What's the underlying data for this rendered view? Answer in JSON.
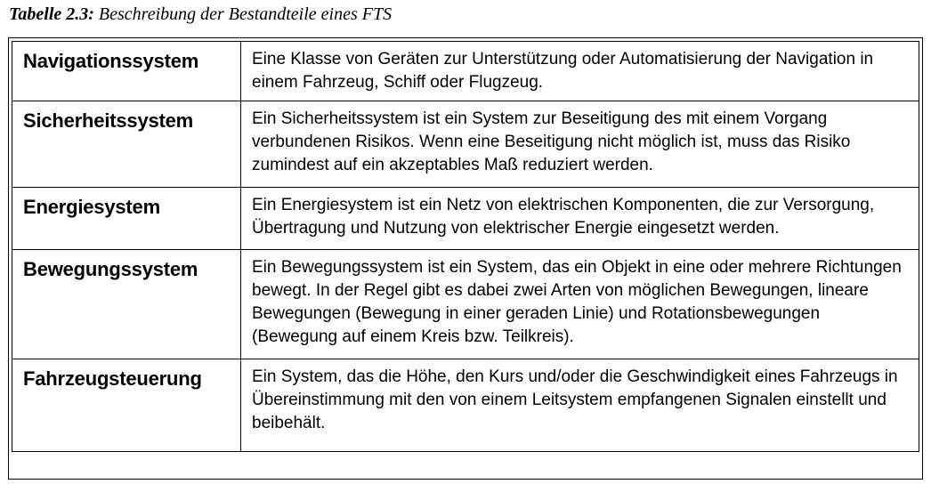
{
  "caption": {
    "label": "Tabelle 2.3:",
    "text": "Beschreibung der Bestandteile eines FTS"
  },
  "table": {
    "rows": [
      {
        "term": "Navigationssystem",
        "definition": "Eine Klasse von Geräten zur Unterstützung oder Automatisierung der Navigation in einem Fahrzeug, Schiff oder Flugzeug."
      },
      {
        "term": "Sicherheitssystem",
        "definition": "Ein Sicherheitssystem ist ein System zur Beseitigung des mit einem Vorgang verbundenen Risikos. Wenn eine Beseitigung nicht möglich ist, muss das Risiko zumindest auf ein akzeptables Maß reduziert werden."
      },
      {
        "term": "Energiesystem",
        "definition": "Ein Energiesystem ist ein Netz von elektrischen Komponenten, die zur Versorgung, Übertragung und Nutzung von elektrischer Energie eingesetzt werden."
      },
      {
        "term": "Bewegungssystem",
        "definition": "Ein Bewegungssystem ist ein System, das ein Objekt in eine oder mehrere Richtungen bewegt. In der Regel gibt es dabei zwei Arten von möglichen Bewegungen, lineare Bewegungen (Bewegung in einer geraden Linie) und Rotationsbewegungen (Bewegung auf einem Kreis bzw. Teilkreis)."
      },
      {
        "term": "Fahrzeugsteuerung",
        "definition": "Ein System, das die Höhe, den Kurs und/oder die Geschwindigkeit eines Fahrzeugs in Übereinstimmung mit den von einem Leitsystem empfangenen Signalen einstellt und beibehält."
      }
    ]
  }
}
